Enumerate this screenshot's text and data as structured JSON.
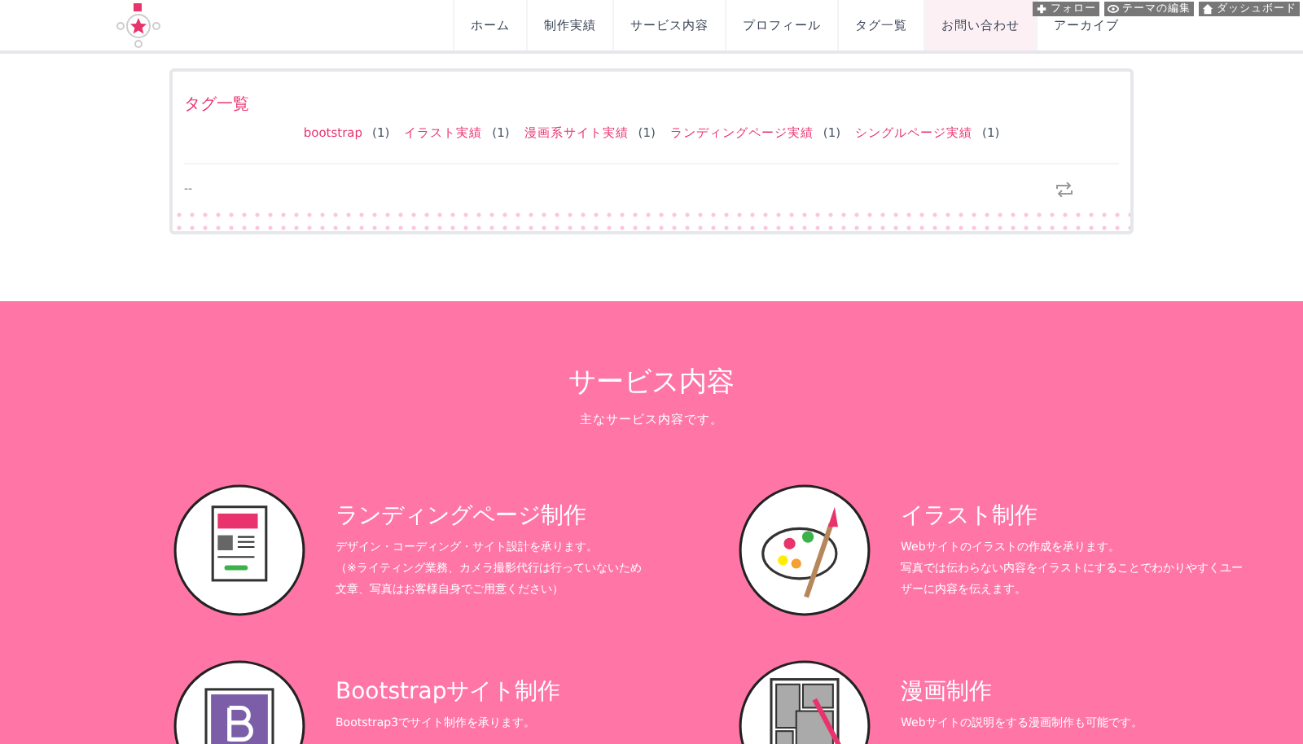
{
  "admin_bar": [
    {
      "kind": "follow",
      "label": "フォロー"
    },
    {
      "kind": "edit",
      "label": "テーマの編集"
    },
    {
      "kind": "dashboard",
      "label": "ダッシュボード"
    }
  ],
  "nav": [
    {
      "label": "ホーム",
      "selected": false
    },
    {
      "label": "制作実績",
      "selected": false
    },
    {
      "label": "サービス内容",
      "selected": false
    },
    {
      "label": "プロフィール",
      "selected": false
    },
    {
      "label": "タグ一覧",
      "selected": false
    },
    {
      "label": "お問い合わせ",
      "selected": true
    },
    {
      "label": "アーカイブ",
      "selected": false
    }
  ],
  "tag_card": {
    "title": "タグ一覧",
    "tags": [
      {
        "label": "bootstrap",
        "count": "(1)"
      },
      {
        "label": "イラスト実績",
        "count": "(1)"
      },
      {
        "label": "漫画系サイト実績",
        "count": "(1)"
      },
      {
        "label": "ランディングページ実績",
        "count": "(1)"
      },
      {
        "label": "シングルページ実績",
        "count": "(1)"
      }
    ],
    "footer_text": "--"
  },
  "services": {
    "title": "サービス内容",
    "subtitle": "主なサービス内容です。",
    "items": [
      {
        "kind": "lp",
        "title": "ランディングページ制作",
        "lines": [
          "デザイン・コーディング・サイト設計を承ります。",
          "（※ライティング業務、カメラ撮影代行は行っていないため",
          "文章、写真はお客様自身でご用意ください）"
        ]
      },
      {
        "kind": "illust",
        "title": "イラスト制作",
        "lines": [
          "Webサイトのイラストの作成を承ります。",
          "写真では伝わらない内容をイラストにすることでわかりやすくユー",
          "ザーに内容を伝えます。"
        ]
      },
      {
        "kind": "bootstrap",
        "title": "Bootstrapサイト制作",
        "lines": [
          "Bootstrap3でサイト制作を承ります。"
        ]
      },
      {
        "kind": "manga",
        "title": "漫画制作",
        "lines": [
          "Webサイトの説明をする漫画制作も可能です。"
        ]
      }
    ]
  }
}
